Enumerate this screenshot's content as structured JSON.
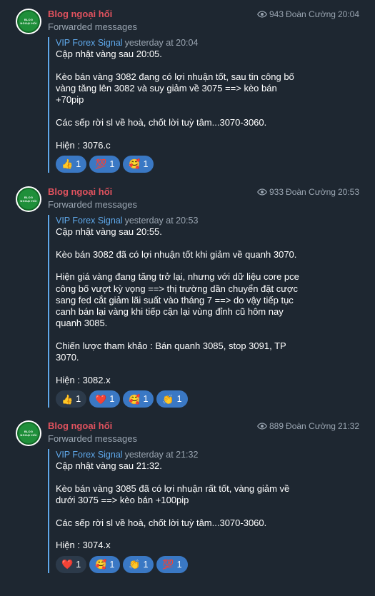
{
  "messages": [
    {
      "sender": "Blog ngoại hối",
      "forwarded_label": "Forwarded messages",
      "views": "943",
      "author": "Đoàn Cường",
      "time": "20:04",
      "fwd_name": "VIP Forex Signal",
      "fwd_time": "yesterday at 20:04",
      "avatar_text": [
        "BLOG",
        "NGOẠI HỐI"
      ],
      "paragraphs": [
        [
          "Cập nhật vàng sau 20:05."
        ],
        [
          "Kèo bán vàng 3082 đang có lợi nhuận tốt, sau tin công bố",
          "vàng tăng lên 3082 và suy giảm về 3075 ==> kèo bán",
          "+70pip"
        ],
        [
          "Các sếp rời sl về hoà, chốt lời tuỳ tâm...3070-3060."
        ],
        [
          "Hiện : 3076.c"
        ]
      ],
      "reactions": [
        {
          "emoji": "👍",
          "icon": "thumbs-up-icon",
          "count": "1",
          "active": true
        },
        {
          "emoji": "💯",
          "icon": "hundred-points-icon",
          "count": "1",
          "active": true
        },
        {
          "emoji": "🥰",
          "icon": "smiling-face-with-hearts-icon",
          "count": "1",
          "active": true
        }
      ]
    },
    {
      "sender": "Blog ngoại hối",
      "forwarded_label": "Forwarded messages",
      "views": "933",
      "author": "Đoàn Cường",
      "time": "20:53",
      "fwd_name": "VIP Forex Signal",
      "fwd_time": "yesterday at 20:53",
      "avatar_text": [
        "BLOG",
        "NGOẠI HỐI"
      ],
      "paragraphs": [
        [
          "Cập nhật vàng sau 20:55."
        ],
        [
          "Kèo bán 3082 đã có lợi nhuận tốt khi giảm về quanh 3070."
        ],
        [
          "Hiện giá vàng đang tăng trở lại, nhưng với dữ liệu core pce",
          "công bố vượt kỳ vọng ==> thị trường dần chuyển đặt cược",
          "sang fed cắt giảm lãi suất vào tháng 7 ==> do vậy tiếp tục",
          "canh bán lại vàng khi tiếp cận lại vùng đỉnh cũ hôm nay",
          "quanh 3085."
        ],
        [
          "Chiến lược tham khảo : Bán quanh 3085, stop 3091, TP",
          "3070."
        ],
        [
          "Hiện : 3082.x"
        ]
      ],
      "reactions": [
        {
          "emoji": "👍",
          "icon": "thumbs-up-icon",
          "count": "1",
          "active": false
        },
        {
          "emoji": "❤️",
          "icon": "heart-icon",
          "count": "1",
          "active": true
        },
        {
          "emoji": "🥰",
          "icon": "smiling-face-with-hearts-icon",
          "count": "1",
          "active": true
        },
        {
          "emoji": "👏",
          "icon": "clapping-hands-icon",
          "count": "1",
          "active": true
        }
      ]
    },
    {
      "sender": "Blog ngoại hối",
      "forwarded_label": "Forwarded messages",
      "views": "889",
      "author": "Đoàn Cường",
      "time": "21:32",
      "fwd_name": "VIP Forex Signal",
      "fwd_time": "yesterday at 21:32",
      "avatar_text": [
        "BLOG",
        "NGOẠI HỐI"
      ],
      "paragraphs": [
        [
          "Cập nhật vàng sau 21:32."
        ],
        [
          "Kèo bán vàng 3085 đã có lợi nhuận rất tốt, vàng giảm về",
          "dưới 3075 ==> kèo bán +100pip"
        ],
        [
          "Các sếp rời sl về hoà, chốt lời tuỳ tâm...3070-3060."
        ],
        [
          "Hiện : 3074.x"
        ]
      ],
      "reactions": [
        {
          "emoji": "❤️",
          "icon": "heart-icon",
          "count": "1",
          "active": false
        },
        {
          "emoji": "🥰",
          "icon": "smiling-face-with-hearts-icon",
          "count": "1",
          "active": true
        },
        {
          "emoji": "👏",
          "icon": "clapping-hands-icon",
          "count": "1",
          "active": true
        },
        {
          "emoji": "💯",
          "icon": "hundred-points-icon",
          "count": "1",
          "active": true
        }
      ]
    }
  ]
}
